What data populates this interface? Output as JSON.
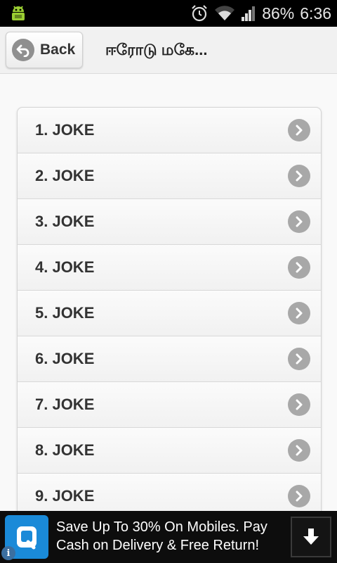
{
  "status_bar": {
    "battery": "86%",
    "time": "6:36",
    "icons": [
      "android-debug-icon",
      "alarm-icon",
      "wifi-icon",
      "signal-icon",
      "battery-icon"
    ]
  },
  "header": {
    "back_label": "Back",
    "title": "ஈரோடு மகே..."
  },
  "list": {
    "items": [
      {
        "label": "1. JOKE"
      },
      {
        "label": "2. JOKE"
      },
      {
        "label": "3. JOKE"
      },
      {
        "label": "4. JOKE"
      },
      {
        "label": "5. JOKE"
      },
      {
        "label": "6. JOKE"
      },
      {
        "label": "7. JOKE"
      },
      {
        "label": "8. JOKE"
      },
      {
        "label": "9. JOKE"
      }
    ]
  },
  "ad": {
    "text": "Save Up To 30% On Mobiles. Pay Cash on Delivery & Free Return!",
    "info_glyph": "i"
  },
  "colors": {
    "status_bar_bg": "#000000",
    "header_bg": "#f1f1f1",
    "chevron_circle": "#a8a8a8",
    "ad_bg": "#0d0d0d",
    "ad_logo": "#1a8ad8"
  }
}
